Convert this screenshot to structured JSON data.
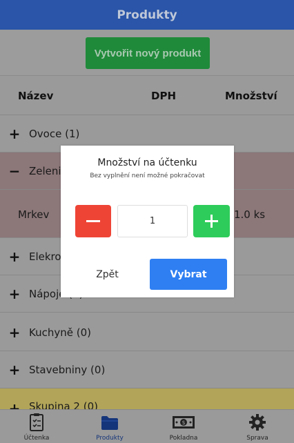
{
  "header": {
    "title": "Produkty"
  },
  "toolbar": {
    "create_label": "Vytvořit nový produkt"
  },
  "table": {
    "columns": [
      "Název",
      "DPH",
      "Množství"
    ]
  },
  "groups": [
    {
      "sign": "+",
      "label": "Ovoce (1)"
    },
    {
      "sign": "−",
      "label": "Zelenina (1)"
    },
    {
      "sign": "+",
      "label": "Elekronika (0)"
    },
    {
      "sign": "+",
      "label": "Nápoje (0)"
    },
    {
      "sign": "+",
      "label": "Kuchyně (0)"
    },
    {
      "sign": "+",
      "label": "Stavebniny (0)"
    },
    {
      "sign": "+",
      "label": "Skupina 2 (0)"
    }
  ],
  "item": {
    "name": "Mrkev",
    "qty": "1.0 ks"
  },
  "dialog": {
    "title": "Množství na účtenku",
    "subtitle": "Bez vyplnění není možné pokračovat",
    "quantity": "1",
    "back_label": "Zpět",
    "select_label": "Vybrat"
  },
  "nav": [
    {
      "icon": "receipt-icon",
      "label": "Účtenka"
    },
    {
      "icon": "folder-icon",
      "label": "Produkty"
    },
    {
      "icon": "cash-icon",
      "label": "Pokladna"
    },
    {
      "icon": "gear-icon",
      "label": "Sprava"
    }
  ],
  "colors": {
    "header": "#2a55a8",
    "create": "#1f8a3a",
    "minus": "#ee4436",
    "plus": "#2ecc5a",
    "select": "#2f7ff2"
  }
}
